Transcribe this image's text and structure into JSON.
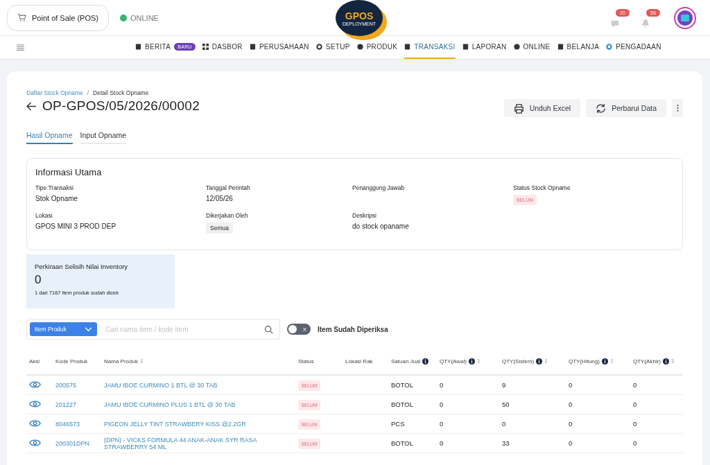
{
  "topbar": {
    "pos_label": "Point of Sale (POS)",
    "status": "ONLINE",
    "online": true,
    "logo_top": "GPOS",
    "logo_bottom": "DEPLOYMENT",
    "badges": [
      "20",
      "56"
    ]
  },
  "nav": [
    {
      "label": "BERITA",
      "tag": "BARU",
      "selected": false
    },
    {
      "label": "DASBOR",
      "selected": false
    },
    {
      "label": "PERUSAHAAN",
      "selected": false
    },
    {
      "label": "SETUP",
      "selected": false
    },
    {
      "label": "PRODUK",
      "selected": false
    },
    {
      "label": "TRANSAKSI",
      "selected": true
    },
    {
      "label": "LAPORAN",
      "selected": false
    },
    {
      "label": "ONLINE",
      "selected": false
    },
    {
      "label": "BELANJA",
      "selected": false
    },
    {
      "label": "PENGADAAN",
      "selected": false
    }
  ],
  "breadcrumb": {
    "items": [
      "Daftar Stock Opname",
      "Detail Stock Opname"
    ],
    "separator": "/"
  },
  "title": "OP-GPOS/05/2026/00002",
  "actions": [
    "Unduh Excel",
    "Perbarui Data"
  ],
  "tabs": [
    {
      "label": "Hasil Opname",
      "selected": true
    },
    {
      "label": "Input Opname",
      "selected": false
    }
  ],
  "info": {
    "title": "Informasi Utama",
    "fields": [
      {
        "label": "Tipe Transaksi",
        "value": "Stok Opname"
      },
      {
        "label": "Lokasi",
        "value": "GPOS MINI 3 PROD DEP"
      },
      {
        "label": "Tanggal Perintah",
        "value": "12/05/26"
      },
      {
        "label": "Dikerjakan Oleh",
        "value": "Semua",
        "kind": "chip"
      },
      {
        "label": "Penanggung Jawab"
      },
      {
        "label": "Deskripsi",
        "value": "do stock opaname"
      },
      {
        "label": "Status Stock Opname",
        "value": "BELUM",
        "kind": "badge"
      }
    ]
  },
  "summary": {
    "title": "Perkiraan Selisih Nilai Inventory",
    "value": "0",
    "note": "1 dari 7167 item produk sudah dicek"
  },
  "filter": {
    "type": "Item Produk",
    "placeholder": "Cari nama item / kode item",
    "toggle_label": "Item Sudah Diperiksa",
    "toggle_on": false,
    "toggle_glyph": "X"
  },
  "table": {
    "columns": [
      {
        "label": "Aksi"
      },
      {
        "label": "Kode Produk"
      },
      {
        "label": "Nama Produk",
        "sortable": true
      },
      {
        "label": "Status"
      },
      {
        "label": "Lokasi Rak"
      },
      {
        "label": "Satuan Jual",
        "info": true
      },
      {
        "label": "QTY(Awal)",
        "info": true,
        "sortable": true
      },
      {
        "label": "QTY(Sistem)",
        "info": true,
        "sortable": true
      },
      {
        "label": "QTY(Hitung)",
        "info": true,
        "sortable": true
      },
      {
        "label": "QTY(Akhir)",
        "info": true,
        "sortable": true
      }
    ],
    "rows": [
      {
        "code": "200575",
        "name": "JAMU IBOE CURMINO 1 BTL @ 30 TAB",
        "status": "BELUM",
        "unit": "BOTOL",
        "awal": "0",
        "sistem": "9",
        "hitung": "0",
        "akhir": "0"
      },
      {
        "code": "201227",
        "name": "JAMU IBOE CURMINO PLUS 1 BTL @ 30 TAB",
        "status": "BELUM",
        "unit": "BOTOL",
        "awal": "0",
        "sistem": "50",
        "hitung": "0",
        "akhir": "0"
      },
      {
        "code": "8046573",
        "name": "PIGEON JELLY TINT STRAWBERY KISS @2.2GR",
        "status": "BELUM",
        "unit": "PCS",
        "awal": "0",
        "sistem": "0",
        "hitung": "0",
        "akhir": "0"
      },
      {
        "code": "200301DPN",
        "name": "(DPN) - VICKS FORMULA 44 ANAK-ANAK SYR RASA STRAWBERRY 54 ML",
        "status": "BELUM",
        "unit": "BOTOL",
        "awal": "0",
        "sistem": "33",
        "hitung": "0",
        "akhir": "0"
      }
    ]
  }
}
